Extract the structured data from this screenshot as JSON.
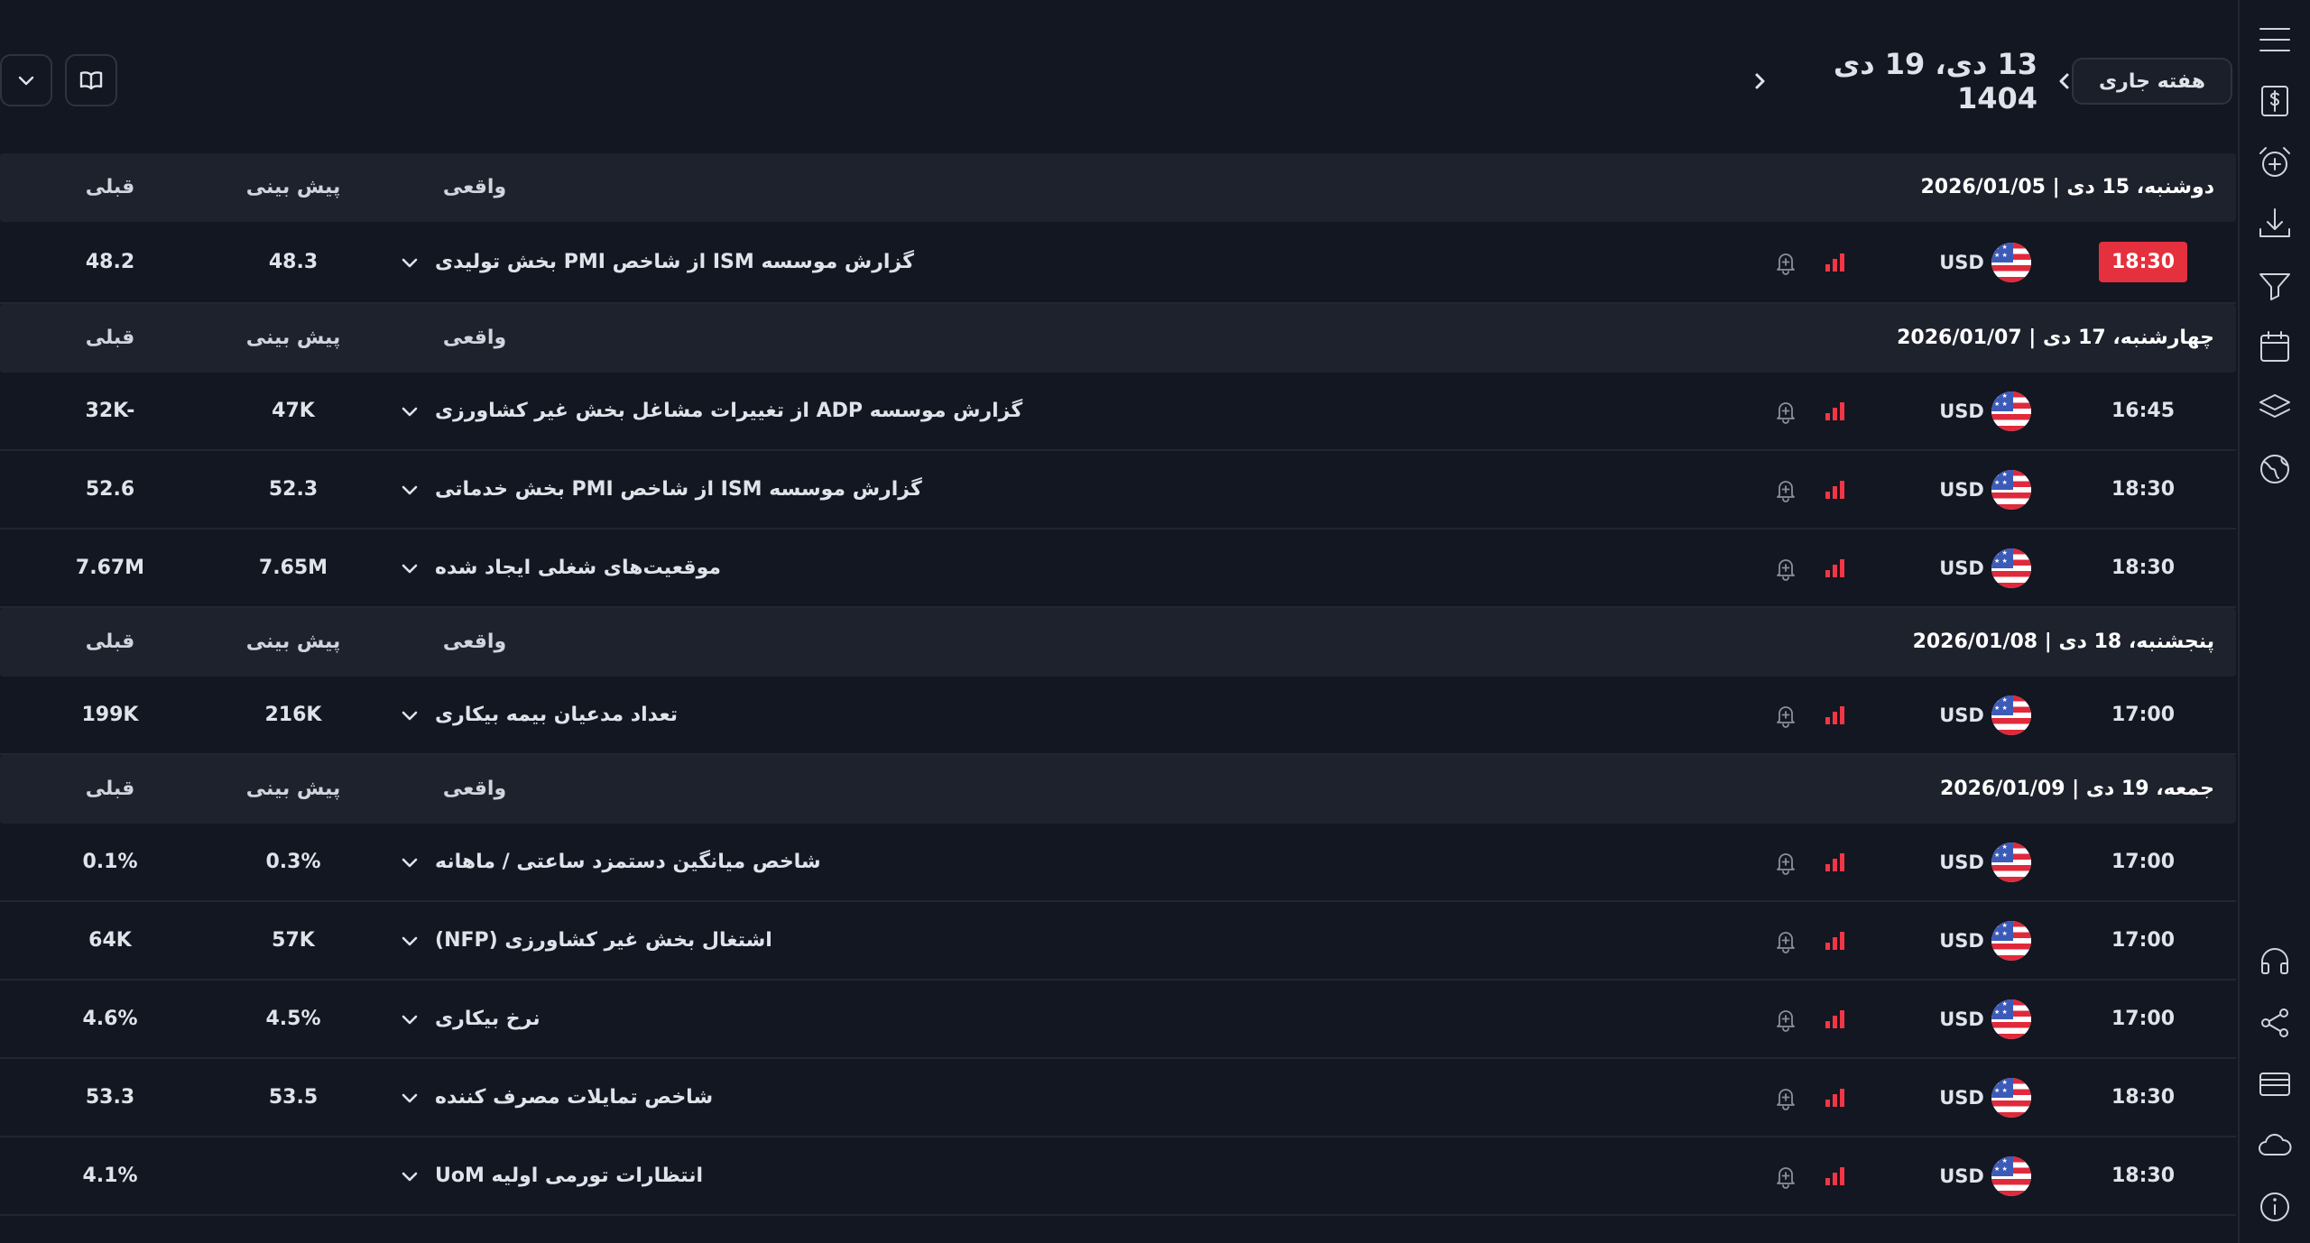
{
  "toolbar": {
    "week_button": "هفته جاری",
    "range": "13 دی، 19 دی 1404"
  },
  "columns": {
    "actual": "واقعی",
    "forecast": "پیش بینی",
    "previous": "قبلی"
  },
  "days": [
    {
      "title": "دوشنبه، 15 دی | 2026/01/05",
      "events": [
        {
          "time": "18:30",
          "highlight": true,
          "currency": "USD",
          "name": "گزارش موسسه ISM از شاخص PMI بخش تولیدی",
          "actual": "",
          "forecast": "48.3",
          "previous": "48.2"
        }
      ]
    },
    {
      "title": "چهارشنبه، 17 دی | 2026/01/07",
      "events": [
        {
          "time": "16:45",
          "highlight": false,
          "currency": "USD",
          "name": "گزارش موسسه ADP از تغییرات مشاغل بخش غیر کشاورزی",
          "actual": "",
          "forecast": "47K",
          "previous": "32K-"
        },
        {
          "time": "18:30",
          "highlight": false,
          "currency": "USD",
          "name": "گزارش موسسه ISM از شاخص PMI بخش خدماتی",
          "actual": "",
          "forecast": "52.3",
          "previous": "52.6"
        },
        {
          "time": "18:30",
          "highlight": false,
          "currency": "USD",
          "name": "موقعیت‌های شغلی ایجاد شده",
          "actual": "",
          "forecast": "7.65M",
          "previous": "7.67M"
        }
      ]
    },
    {
      "title": "پنجشنبه، 18 دی | 2026/01/08",
      "events": [
        {
          "time": "17:00",
          "highlight": false,
          "currency": "USD",
          "name": "تعداد مدعیان بیمه بیکاری",
          "actual": "",
          "forecast": "216K",
          "previous": "199K"
        }
      ]
    },
    {
      "title": "جمعه، 19 دی | 2026/01/09",
      "events": [
        {
          "time": "17:00",
          "highlight": false,
          "currency": "USD",
          "name": "شاخص میانگین دستمزد ساعتی / ماهانه",
          "actual": "",
          "forecast": "0.3%",
          "previous": "0.1%"
        },
        {
          "time": "17:00",
          "highlight": false,
          "currency": "USD",
          "name": "اشتغال بخش غیر کشاورزی (NFP)",
          "actual": "",
          "forecast": "57K",
          "previous": "64K"
        },
        {
          "time": "17:00",
          "highlight": false,
          "currency": "USD",
          "name": "نرخ بیکاری",
          "actual": "",
          "forecast": "4.5%",
          "previous": "4.6%"
        },
        {
          "time": "18:30",
          "highlight": false,
          "currency": "USD",
          "name": "شاخص تمایلات مصرف کننده",
          "actual": "",
          "forecast": "53.5",
          "previous": "53.3"
        },
        {
          "time": "18:30",
          "highlight": false,
          "currency": "USD",
          "name": "انتظارات تورمی اولیه UoM",
          "actual": "",
          "forecast": "",
          "previous": "4.1%"
        }
      ]
    }
  ],
  "sidebar": {
    "top_icons": [
      "menu-icon",
      "dollar-icon",
      "alarm-add-icon",
      "download-icon",
      "filter-icon",
      "calendar-icon",
      "layers-icon",
      "globe-icon"
    ],
    "bottom_icons": [
      "headset-icon",
      "share-icon",
      "card-icon",
      "cloud-icon",
      "info-icon"
    ]
  },
  "colors": {
    "background": "#131722",
    "header_row": "#1e222d",
    "accent_red": "#f23645",
    "highlight_time": "#e5303d"
  }
}
